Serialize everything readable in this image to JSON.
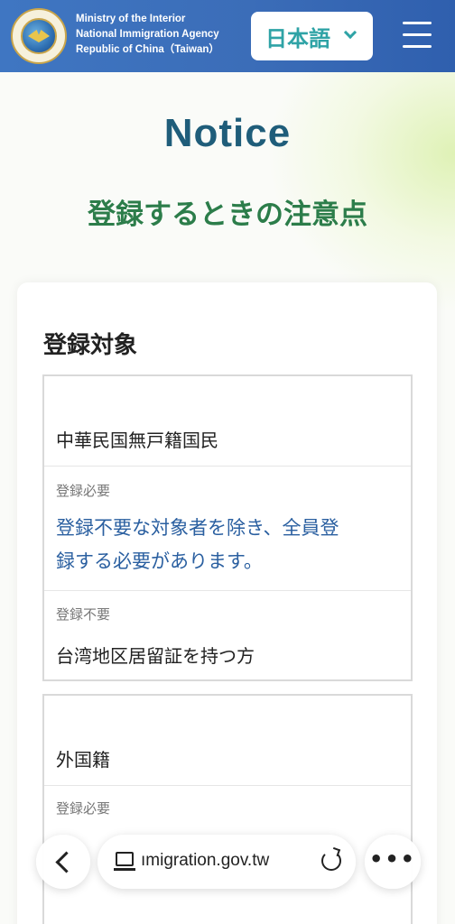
{
  "header": {
    "agency_line1": "Ministry of the Interior",
    "agency_line2": "National Immigration Agency",
    "agency_line3": "Republic of China（Taiwan）",
    "language": "日本語",
    "colors": {
      "bar": "#3b6db8",
      "accent": "#2fa3a6"
    }
  },
  "hero": {
    "title": "Notice",
    "subtitle": "登録するときの注意点"
  },
  "section": {
    "title": "登録対象",
    "groups": [
      {
        "heading": "中華民国無戸籍国民",
        "required_label": "登録必要",
        "required_text_line1": "登録不要な対象者を除き、全員登",
        "required_text_line2": "録する必要があります。",
        "not_required_label": "登録不要",
        "not_required_text": "台湾地区居留証を持つ方"
      },
      {
        "heading": "外国籍",
        "required_label": "登録必要"
      }
    ]
  },
  "browser": {
    "url": "ımigration.gov.tw",
    "more": "•••"
  }
}
